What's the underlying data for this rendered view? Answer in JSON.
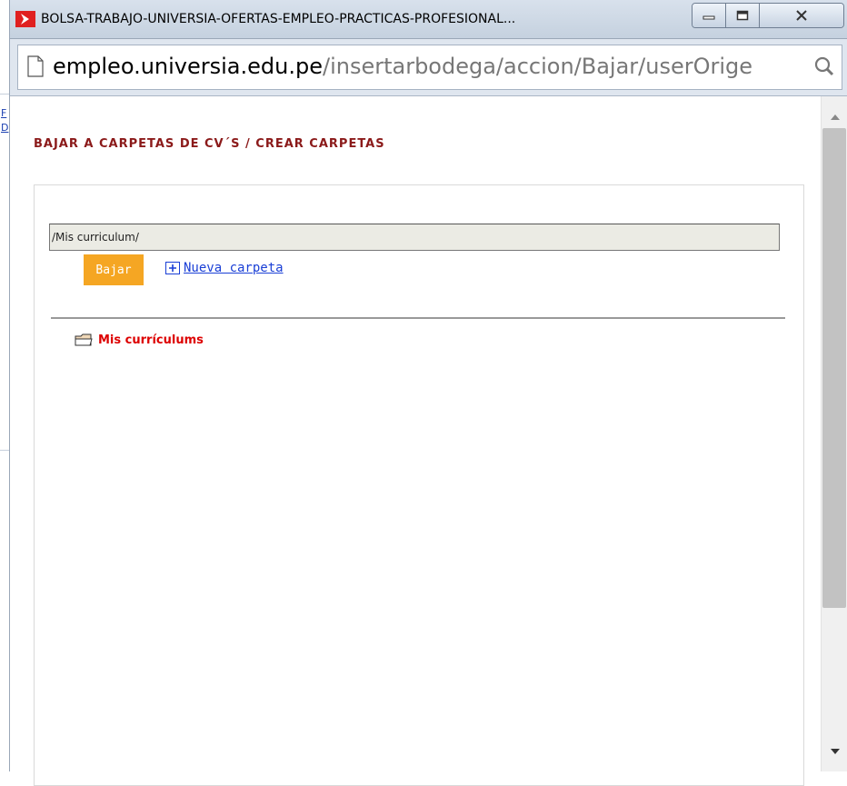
{
  "window": {
    "title": "BOLSA-TRABAJO-UNIVERSIA-OFERTAS-EMPLEO-PRACTICAS-PROFESIONAL...",
    "buttons": [
      "minimize",
      "maximize",
      "close"
    ]
  },
  "address": {
    "domain": "empleo.universia.edu.pe",
    "path": "/insertarbodega/accion/Bajar/userOrige"
  },
  "page": {
    "heading": "BAJAR A CARPETAS DE CV´S / CREAR CARPETAS",
    "path_field_value": "/Mis curriculum/",
    "bajar_label": "Bajar",
    "new_folder_label": "Nueva carpeta",
    "folders": [
      {
        "label": "Mis currículums"
      }
    ]
  },
  "colors": {
    "heading": "#8b1a1a",
    "bajar_button": "#f5a623",
    "link": "#1a3fd6",
    "folder_link": "#dd0000"
  },
  "icons": {
    "app": "universia-logo-icon",
    "page": "page-icon",
    "zoom": "magnifier-icon",
    "new_folder": "new-folder-icon",
    "folder": "folder-icon"
  }
}
